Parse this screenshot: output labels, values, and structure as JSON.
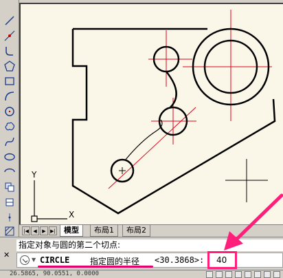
{
  "toolbar": {
    "tools": [
      {
        "name": "line-tool",
        "icon": "line-icon"
      },
      {
        "name": "construction-line-tool",
        "icon": "xline-icon"
      },
      {
        "name": "polyline-tool",
        "icon": "polyline-icon"
      },
      {
        "name": "polygon-tool",
        "icon": "polygon-icon"
      },
      {
        "name": "rectangle-tool",
        "icon": "rectangle-icon"
      },
      {
        "name": "arc-tool",
        "icon": "arc-icon"
      },
      {
        "name": "circle-tool",
        "icon": "circle-icon"
      },
      {
        "name": "revision-cloud-tool",
        "icon": "cloud-icon"
      },
      {
        "name": "spline-tool",
        "icon": "spline-icon"
      },
      {
        "name": "ellipse-tool",
        "icon": "ellipse-icon"
      },
      {
        "name": "ellipse-arc-tool",
        "icon": "ellipse-arc-icon"
      },
      {
        "name": "insert-block-tool",
        "icon": "block-icon"
      },
      {
        "name": "make-block-tool",
        "icon": "make-block-icon"
      },
      {
        "name": "point-tool",
        "icon": "point-icon"
      },
      {
        "name": "hatch-tool",
        "icon": "hatch-icon"
      },
      {
        "name": "gradient-tool",
        "icon": "gradient-icon"
      },
      {
        "name": "region-tool",
        "icon": "region-icon"
      }
    ]
  },
  "ucs": {
    "x_label": "X",
    "y_label": "Y"
  },
  "tabs": {
    "model": "模型",
    "layout1": "布局1",
    "layout2": "布局2"
  },
  "command": {
    "history_line": "指定对象与圆的第二个切点:",
    "keyword": "CIRCLE",
    "prompt": "指定圆的半径",
    "default_value": "<30.3868>:",
    "input_value": "40"
  },
  "status": {
    "coordinates": "26.5865, 90.0551, 0.0000"
  },
  "colors": {
    "canvas_bg": "#fbf7e8",
    "geometry": "#000000",
    "centerline": "#e0001a",
    "highlight": "#ff1f7a"
  }
}
